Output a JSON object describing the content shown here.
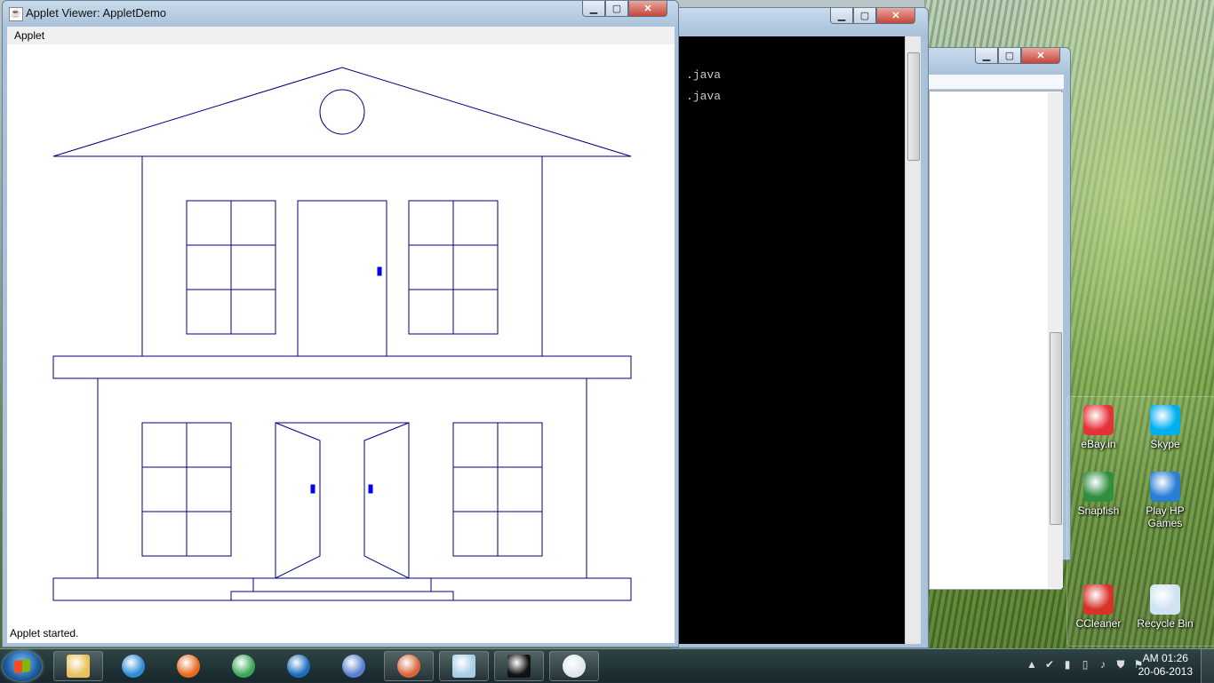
{
  "applet_window": {
    "title": "Applet Viewer: AppletDemo",
    "menu": "Applet",
    "status": "Applet started.",
    "controls": {
      "minimize": "▁",
      "maximize": "▢",
      "close": "✕"
    }
  },
  "console_window": {
    "lines": [
      ".java",
      ".java"
    ]
  },
  "desktop_icons": [
    {
      "label": "eBay.in",
      "color": "#e53238"
    },
    {
      "label": "Skype",
      "color": "#00aff0"
    },
    {
      "label": "Snapfish",
      "color": "#2f8f3f"
    },
    {
      "label": "Play HP Games",
      "color": "#2a7fd4"
    },
    {
      "label": "CCleaner",
      "color": "#d8322a"
    },
    {
      "label": "Recycle Bin",
      "color": "#cfe3f2"
    }
  ],
  "taskbar": {
    "apps": [
      {
        "name": "explorer-icon",
        "color": "#e8c25a"
      },
      {
        "name": "ie-icon",
        "color": "#2d8bd8"
      },
      {
        "name": "firefox-icon",
        "color": "#e86a1f"
      },
      {
        "name": "chrome-icon",
        "color": "#3aa757"
      },
      {
        "name": "hp-icon",
        "color": "#1b6cc0"
      },
      {
        "name": "crystal-icon",
        "color": "#5a7fd0"
      },
      {
        "name": "photo-icon",
        "color": "#d9643a"
      },
      {
        "name": "notepad-icon",
        "color": "#a9cfe6"
      },
      {
        "name": "cmd-icon",
        "color": "#111111"
      },
      {
        "name": "java-icon",
        "color": "#e0e8ef"
      }
    ],
    "clock_time": "AM 01:26",
    "clock_date": "20-06-2013"
  },
  "drawing_color": "#00007f"
}
